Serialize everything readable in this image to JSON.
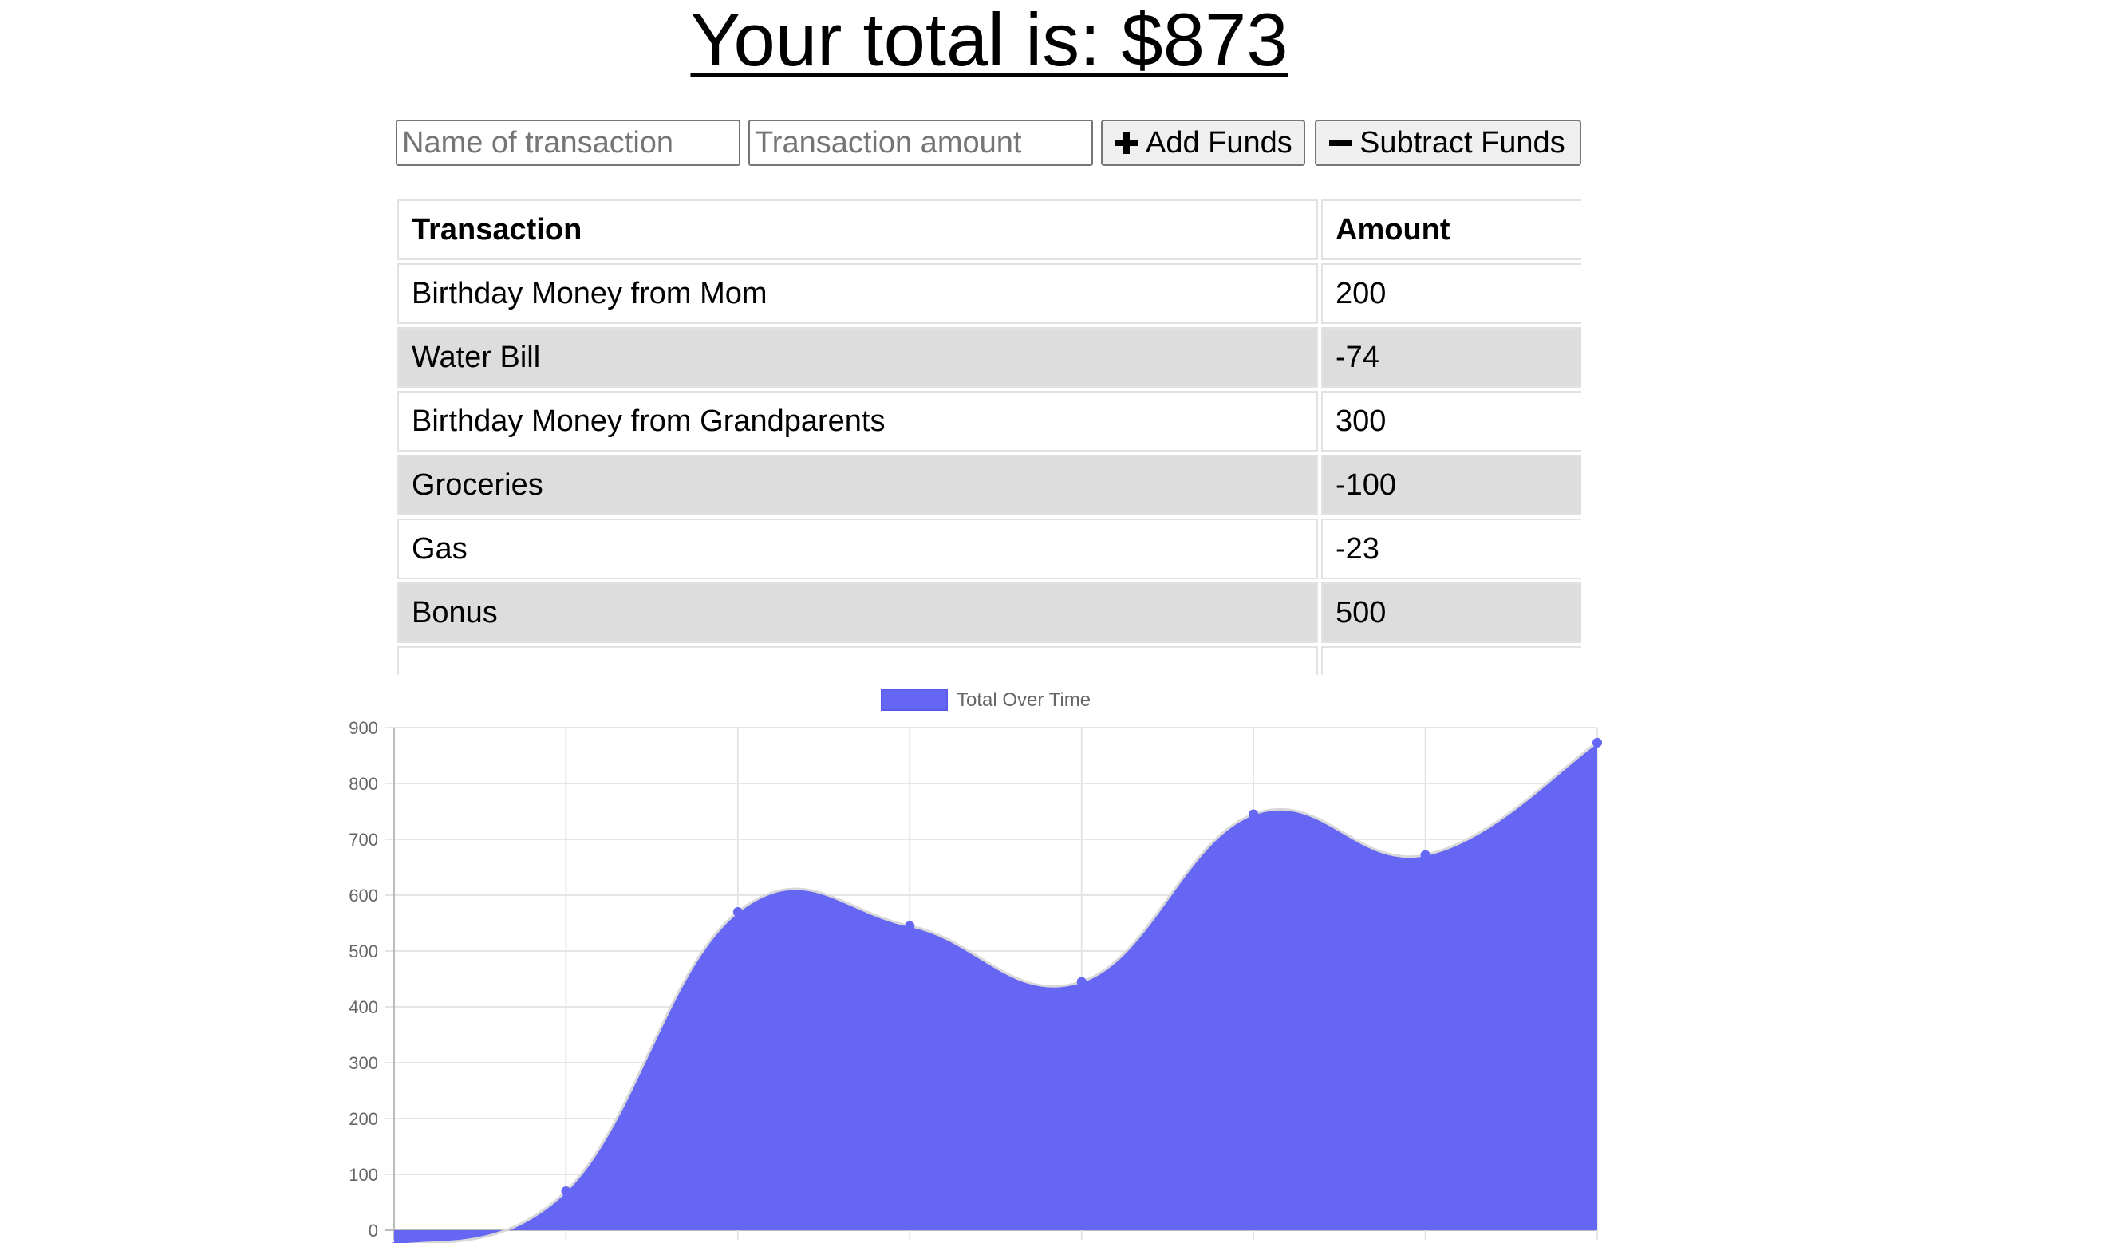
{
  "header": {
    "title": "Your total is: $873"
  },
  "form": {
    "name_placeholder": "Name of transaction",
    "amount_placeholder": "Transaction amount",
    "add_label": "Add Funds",
    "subtract_label": "Subtract Funds"
  },
  "table": {
    "headers": [
      "Transaction",
      "Amount"
    ],
    "rows": [
      {
        "name": "Birthday Money from Mom",
        "amount": "200"
      },
      {
        "name": "Water Bill",
        "amount": "-74"
      },
      {
        "name": "Birthday Money from Grandparents",
        "amount": "300"
      },
      {
        "name": "Groceries",
        "amount": "-100"
      },
      {
        "name": "Gas",
        "amount": "-23"
      },
      {
        "name": "Bonus",
        "amount": "500"
      }
    ]
  },
  "chart_data": {
    "type": "area",
    "series": [
      {
        "name": "Total Over Time",
        "values": [
          -30,
          70,
          570,
          545,
          445,
          745,
          672,
          873
        ],
        "color": "#6666f4"
      }
    ],
    "ylim": [
      0,
      900
    ],
    "yticks": [
      "900",
      "800",
      "700",
      "600",
      "500",
      "400",
      "300",
      "200",
      "100",
      "0"
    ],
    "grid": true,
    "legend_position": "top"
  }
}
